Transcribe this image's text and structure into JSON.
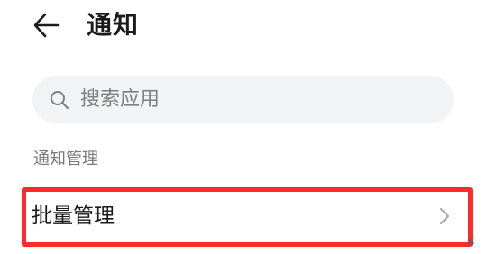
{
  "header": {
    "back_icon": "arrow-left-icon",
    "title": "通知"
  },
  "search": {
    "icon": "search-icon",
    "placeholder": "搜索应用"
  },
  "section": {
    "title": "通知管理"
  },
  "list": {
    "items": [
      {
        "label": "批量管理",
        "icon": "chevron-right-icon"
      }
    ]
  },
  "highlight": {
    "color": "#ff2a2a"
  },
  "corner_mark": "#"
}
